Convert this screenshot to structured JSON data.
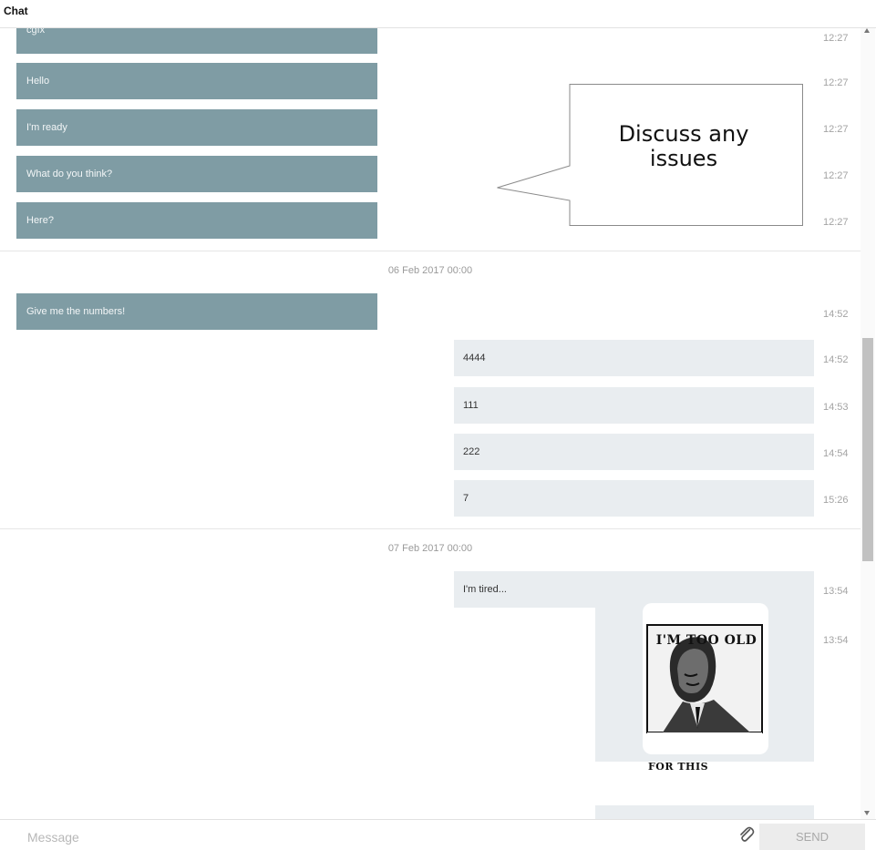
{
  "header": {
    "title": "Chat"
  },
  "colors": {
    "incoming_bubble": "#7f9ca4",
    "outgoing_bubble": "#e9edf0",
    "scroll_thumb": "#c1c1c1"
  },
  "messages_group_1": [
    {
      "text": "cgfx",
      "time": "12:27",
      "direction": "incoming"
    },
    {
      "text": "Hello",
      "time": "12:27",
      "direction": "incoming"
    },
    {
      "text": "I'm ready",
      "time": "12:27",
      "direction": "incoming"
    },
    {
      "text": "What do you think?",
      "time": "12:27",
      "direction": "incoming"
    },
    {
      "text": "Here?",
      "time": "12:27",
      "direction": "incoming"
    }
  ],
  "date_separator_1": "06 Feb 2017 00:00",
  "messages_group_2": [
    {
      "text": "Give me the numbers!",
      "time": "14:52",
      "direction": "incoming"
    },
    {
      "text": "4444",
      "time": "14:52",
      "direction": "outgoing"
    },
    {
      "text": "111",
      "time": "14:53",
      "direction": "outgoing"
    },
    {
      "text": "222",
      "time": "14:54",
      "direction": "outgoing"
    },
    {
      "text": "7",
      "time": "15:26",
      "direction": "outgoing"
    }
  ],
  "date_separator_2": "07 Feb 2017 00:00",
  "messages_group_3": [
    {
      "text": "I'm tired...",
      "time": "13:54",
      "direction": "outgoing"
    },
    {
      "image_top_text": "I'M TOO OLD",
      "image_bottom_text": "FOR THIS",
      "time": "13:54",
      "direction": "outgoing"
    }
  ],
  "callout": {
    "text_line1": "Discuss any",
    "text_line2": "issues"
  },
  "composer": {
    "placeholder": "Message",
    "send_label": "SEND",
    "attach_icon": "paperclip-icon"
  }
}
